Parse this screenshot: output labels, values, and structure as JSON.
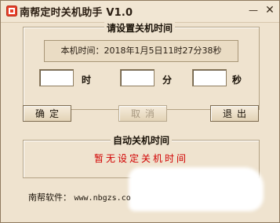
{
  "window": {
    "title": "南帮定时关机助手 V1.0",
    "minimize_glyph": "—",
    "close_glyph": "✕"
  },
  "set_time_group": {
    "title": "请设置关机时间",
    "current_time_label": "本机时间：2018年1月5日11时27分38秒",
    "hour_value": "",
    "minute_value": "",
    "second_value": "",
    "hour_unit": "时",
    "minute_unit": "分",
    "second_unit": "秒"
  },
  "buttons": {
    "confirm": "确定",
    "cancel": "取消",
    "exit": "退出"
  },
  "auto_group": {
    "title": "自动关机时间",
    "status": "暂无设定关机时间"
  },
  "footer": {
    "label": "南帮软件：",
    "url": "www.nbgzs.co"
  },
  "colors": {
    "background": "#efe3cf",
    "status_text": "#d10000",
    "border": "#b3a284"
  },
  "icons": {
    "app": "app-logo-icon"
  }
}
